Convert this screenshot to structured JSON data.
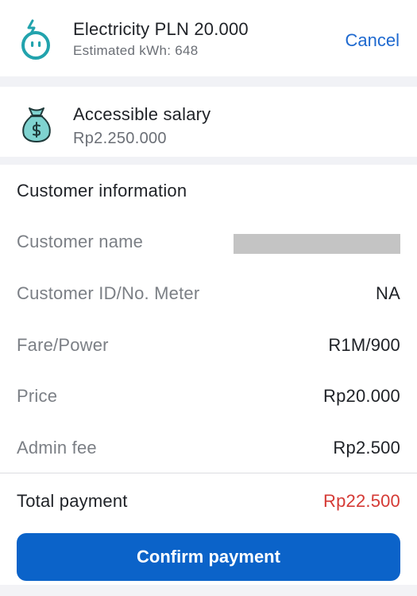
{
  "product": {
    "title": "Electricity PLN 20.000",
    "subtitle": "Estimated kWh: 648",
    "icon": "electricity-icon"
  },
  "header": {
    "cancel_label": "Cancel"
  },
  "funding": {
    "title": "Accessible salary",
    "amount": "Rp2.250.000",
    "icon": "money-bag-icon"
  },
  "customer_info": {
    "heading": "Customer information",
    "rows": [
      {
        "label": "Customer name",
        "value": ""
      },
      {
        "label": "Customer ID/No. Meter",
        "value": "NA"
      },
      {
        "label": "Fare/Power",
        "value": "R1M/900"
      },
      {
        "label": "Price",
        "value": "Rp20.000"
      },
      {
        "label": "Admin fee",
        "value": "Rp2.500"
      }
    ]
  },
  "total": {
    "label": "Total payment",
    "value": "Rp22.500"
  },
  "actions": {
    "confirm_label": "Confirm payment"
  },
  "colors": {
    "accent": "#0b63c9",
    "link": "#1e69cf",
    "total": "#d53a35",
    "icon_teal": "#22a3ad",
    "bag_fill": "#7fd3d0"
  }
}
